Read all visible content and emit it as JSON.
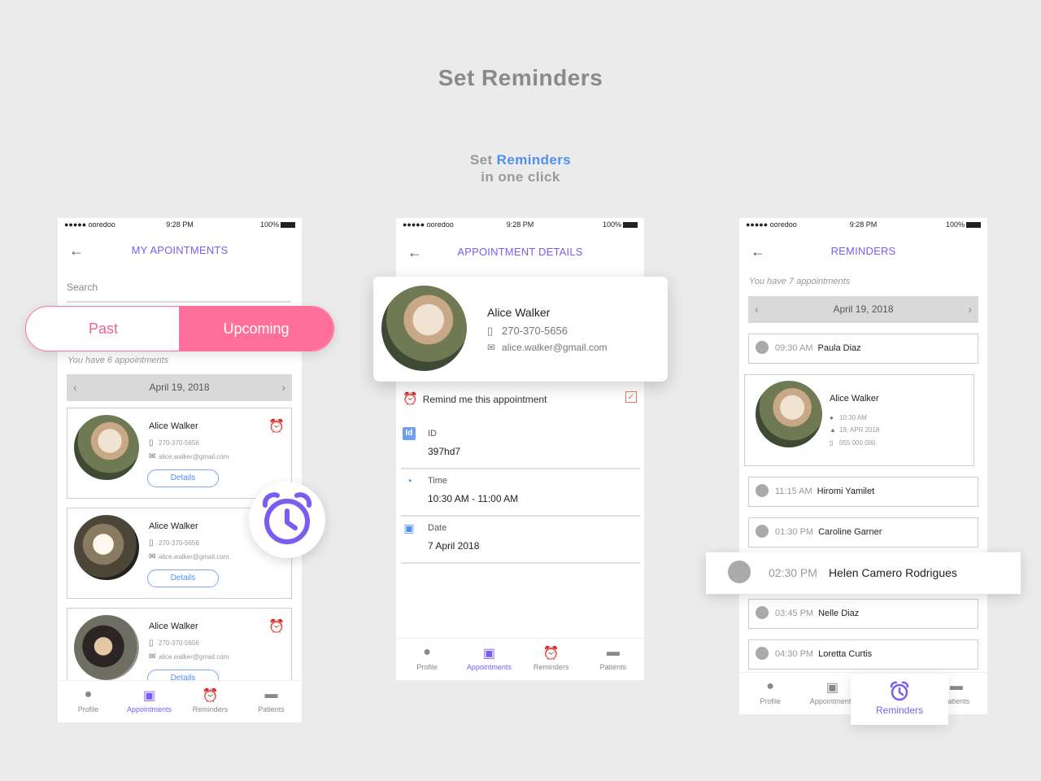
{
  "header": {
    "title": "Set Reminders"
  },
  "tagline": {
    "prefix": "Set",
    "accent": "Reminders",
    "line2": "in one click"
  },
  "status_bar": {
    "carrier": "●●●●● ooredoo",
    "time": "9:28 PM",
    "battery": "100%"
  },
  "tabs": [
    "Profile",
    "Appointments",
    "Reminders",
    "Patients"
  ],
  "screen1": {
    "title": "MY APOINTMENTS",
    "search_placeholder": "Search",
    "toggle": {
      "past": "Past",
      "upcoming": "Upcoming"
    },
    "counter": "You have 6 appointments",
    "date": "April 19, 2018",
    "cards": [
      {
        "name": "Alice Walker",
        "phone": "270-370-5656",
        "email": "alice.walker@gmail.com",
        "button": "Details"
      },
      {
        "name": "Alice Walker",
        "phone": "270-370-5656",
        "email": "alice.walker@gmail.com",
        "button": "Details"
      },
      {
        "name": "Alice Walker",
        "phone": "270-370-5656",
        "email": "alice.walker@gmail.com",
        "button": "Details"
      }
    ]
  },
  "screen2": {
    "title": "APPOINTMENT DETAILS",
    "patient": {
      "name": "Alice Walker",
      "phone": "270-370-5656",
      "email": "alice.walker@gmail.com"
    },
    "remind_label": "Remind me this appointment",
    "fields": [
      {
        "label": "ID",
        "value": "397hd7"
      },
      {
        "label": "Time",
        "value": "10:30 AM - 11:00 AM"
      },
      {
        "label": "Date",
        "value": "7 April 2018"
      }
    ]
  },
  "screen3": {
    "title": "REMINDERS",
    "counter": "You have 7 appointments",
    "date": "April 19, 2018",
    "featured": {
      "name": "Alice Walker",
      "time": "10:30 AM",
      "date": "19, APR 2018",
      "phone": "055 000 000"
    },
    "reminders": [
      {
        "time": "09:30 AM",
        "name": "Paula Diaz"
      },
      {
        "time": "11:15 AM",
        "name": "Hiromi Yamilet"
      },
      {
        "time": "01:30 PM",
        "name": "Caroline Garner"
      },
      {
        "time": "02:30 PM",
        "name": "Helen Camero Rodrigues"
      },
      {
        "time": "03:45 PM",
        "name": "Nelle Diaz"
      },
      {
        "time": "04:30 PM",
        "name": "Loretta Curtis"
      }
    ]
  },
  "colors": {
    "accent": "#7b5cf0",
    "blue": "#4f8ff0",
    "pink": "#ff6f9c",
    "background": "#ebebeb"
  }
}
